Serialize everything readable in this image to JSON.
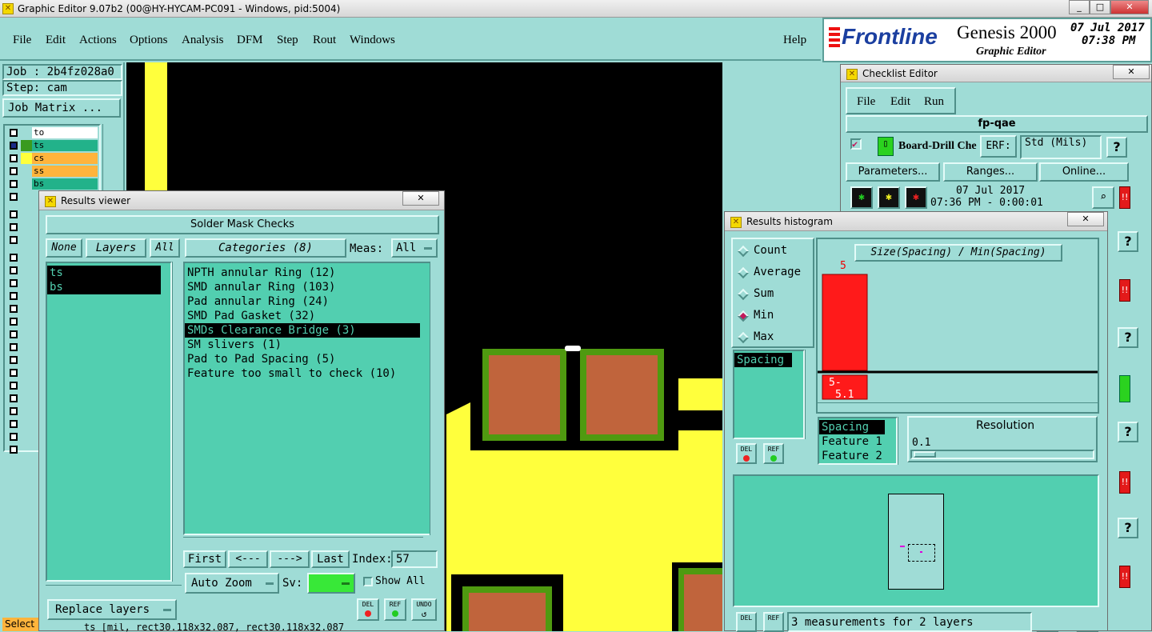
{
  "window": {
    "title": "Graphic Editor 9.07b2 (00@HY-HYCAM-PC091 - Windows, pid:5004)"
  },
  "menu": {
    "items": [
      "File",
      "Edit",
      "Actions",
      "Options",
      "Analysis",
      "DFM",
      "Step",
      "Rout",
      "Windows"
    ],
    "help": "Help"
  },
  "brand": {
    "logo": "Frontline",
    "product": "Genesis 2000",
    "subtitle": "Graphic Editor",
    "date": "07 Jul 2017",
    "time": "07:38 PM"
  },
  "job": {
    "job_label": "Job : 2b4fz028a0",
    "step_label": "Step: cam",
    "matrix_button": "Job Matrix ..."
  },
  "layers": [
    {
      "name": "to",
      "color": "#ffffff"
    },
    {
      "name": "ts",
      "color": "#22b28a"
    },
    {
      "name": "cs",
      "color": "#ffb43c"
    },
    {
      "name": "ss",
      "color": "#ffb43c"
    },
    {
      "name": "bs",
      "color": "#22b28a"
    }
  ],
  "status": {
    "select_label": "Select",
    "bottom_text": "ts [mil, rect30.118x32.087, rect30.118x32.087"
  },
  "results_viewer": {
    "title": "Results viewer",
    "header": "Solder Mask Checks",
    "none_btn": "None",
    "layers_btn": "Layers",
    "all_btn": "All",
    "layers_list": [
      "ts",
      "bs"
    ],
    "categories_label": "Categories (8)",
    "meas_label": "Meas:",
    "meas_value": "All",
    "categories": [
      "NPTH annular Ring (12)",
      "SMD annular Ring (103)",
      "Pad annular Ring (24)",
      "SMD Pad Gasket (32)",
      "SMDs Clearance Bridge (3)",
      "SM slivers (1)",
      "Pad to Pad Spacing (5)",
      "Feature too small to check (10)"
    ],
    "selected_category": 4,
    "first": "First",
    "prev": "<---",
    "next": "--->",
    "last": "Last",
    "index_label": "Index:",
    "index_value": "57",
    "auto_zoom": "Auto Zoom",
    "sv_label": "Sv:",
    "show_all": "Show All",
    "replace_layers": "Replace layers",
    "del": "DEL",
    "ref": "REF",
    "undo": "UNDO"
  },
  "checklist": {
    "title": "Checklist Editor",
    "menu": [
      "File",
      "Edit",
      "Run"
    ],
    "name": "fp-qae",
    "action": "Board-Drill Che",
    "erf_label": "ERF:",
    "erf_value": "Std (Mils)",
    "parameters": "Parameters...",
    "ranges": "Ranges...",
    "online": "Online...",
    "run_date": "07 Jul 2017",
    "run_time": "07:36 PM - 0:00:01",
    "help_q": "?"
  },
  "histogram": {
    "title": "Results histogram",
    "modes": [
      "Count",
      "Average",
      "Sum",
      "Min",
      "Max"
    ],
    "selected_mode": 3,
    "chart_title": "Size(Spacing) / Min(Spacing)",
    "bar_value_label": "5",
    "range_low": "5-",
    "range_high": "5.1",
    "list_left": [
      "Spacing"
    ],
    "list_bottom": [
      "Spacing",
      "Feature 1",
      "Feature 2"
    ],
    "resolution_label": "Resolution",
    "resolution_value": "0.1",
    "del": "DEL",
    "ref": "REF",
    "summary": "3 measurements for 2 layers"
  },
  "colors": {
    "teal": "#52cfb0",
    "panel": "#9fdcd6",
    "pad_yellow": "#ffff3c",
    "copper": "#c0643c",
    "mask_green": "#4f9a10",
    "bar_red": "#ff1a1a"
  }
}
